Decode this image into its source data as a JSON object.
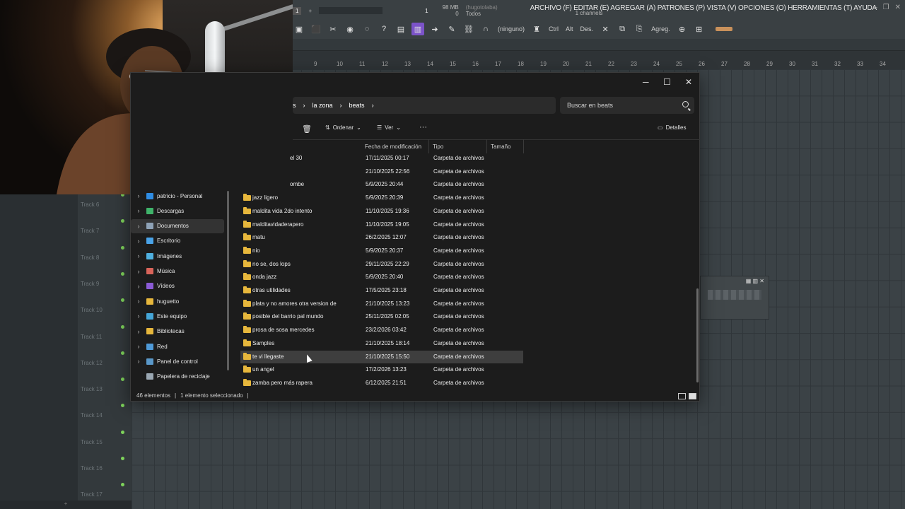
{
  "fl": {
    "menu": "ARCHIVO (F) EDITAR (E) AGREGAR (A) PATRONES (P) VISTA (V) OPCIONES (O) HERRAMIENTAS (T) AYUDA",
    "top_field": "1",
    "meter_value": "1",
    "memory": "98 MB",
    "memory_count": "0",
    "user_hint": "(hugotolaba)",
    "channels_filter": "Todos",
    "channels": "1 channels",
    "toolbar_none": "(ninguno)",
    "ctrl": "Ctrl",
    "alt": "Alt",
    "des": "Des.",
    "agreg": "Agreg.",
    "ruler": [
      "9",
      "10",
      "11",
      "12",
      "13",
      "14",
      "15",
      "16",
      "17",
      "18",
      "19",
      "20",
      "21",
      "22",
      "23",
      "24",
      "25",
      "26",
      "27",
      "28",
      "29",
      "30",
      "31",
      "32",
      "33",
      "34"
    ],
    "tracks": [
      "Track 6",
      "Track 7",
      "Track 8",
      "Track 9",
      "Track 10",
      "Track 11",
      "Track 12",
      "Track 13",
      "Track 14",
      "Track 15",
      "Track 16",
      "Track 17"
    ],
    "plus": "+"
  },
  "explorer": {
    "breadcrumb": [
      "s",
      "la zona",
      "beats"
    ],
    "search_placeholder": "Buscar en beats",
    "cmd_sort": "Ordenar",
    "cmd_view": "Ver",
    "cmd_more": "···",
    "cmd_details": "Detalles",
    "columns": {
      "date": "Fecha de modificación",
      "type": "Tipo",
      "size": "Tamaño"
    },
    "nav": [
      {
        "label": "patricio - Personal",
        "color": "#2f8de4"
      },
      {
        "label": "Descargas",
        "color": "#3fb36a"
      },
      {
        "label": "Documentos",
        "color": "#8ea2b6"
      },
      {
        "label": "Escritorio",
        "color": "#4aa3e8"
      },
      {
        "label": "Imágenes",
        "color": "#4fb0e0"
      },
      {
        "label": "Música",
        "color": "#d9645a"
      },
      {
        "label": "Vídeos",
        "color": "#8b5bd6"
      },
      {
        "label": "huguetto",
        "color": "#e7b73c"
      },
      {
        "label": "Este equipo",
        "color": "#45a6d8"
      },
      {
        "label": "Bibliotecas",
        "color": "#e7b73c"
      },
      {
        "label": "Red",
        "color": "#4f9ad8"
      },
      {
        "label": "Panel de control",
        "color": "#5a98c9"
      },
      {
        "label": "Papelera de reciclaje",
        "color": "#9aa7b2"
      }
    ],
    "files": [
      {
        "name": "el 30",
        "date": "17/11/2025 00:17",
        "type": "Carpeta de archivos"
      },
      {
        "name": "",
        "date": "21/10/2025 22:56",
        "type": "Carpeta de archivos"
      },
      {
        "name": "ombe",
        "date": "5/9/2025 20:44",
        "type": "Carpeta de archivos"
      },
      {
        "name": "jazz ligero",
        "date": "5/9/2025 20:39",
        "type": "Carpeta de archivos"
      },
      {
        "name": "maldita vida 2do intento",
        "date": "11/10/2025 19:36",
        "type": "Carpeta de archivos"
      },
      {
        "name": "malditavidaderapero",
        "date": "11/10/2025 19:05",
        "type": "Carpeta de archivos"
      },
      {
        "name": "matu",
        "date": "26/2/2025 12:07",
        "type": "Carpeta de archivos"
      },
      {
        "name": "nio",
        "date": "5/9/2025 20:37",
        "type": "Carpeta de archivos"
      },
      {
        "name": "no se, dos lops",
        "date": "29/11/2025 22:29",
        "type": "Carpeta de archivos"
      },
      {
        "name": "onda jazz",
        "date": "5/9/2025 20:40",
        "type": "Carpeta de archivos"
      },
      {
        "name": "otras utilidades",
        "date": "17/5/2025 23:18",
        "type": "Carpeta de archivos"
      },
      {
        "name": "plata y no amores otra version de",
        "date": "21/10/2025 13:23",
        "type": "Carpeta de archivos"
      },
      {
        "name": "posible del barrio pal mundo",
        "date": "25/11/2025 02:05",
        "type": "Carpeta de archivos"
      },
      {
        "name": "prosa de sosa mercedes",
        "date": "23/2/2026 03:42",
        "type": "Carpeta de archivos"
      },
      {
        "name": "Samples",
        "date": "21/10/2025 18:14",
        "type": "Carpeta de archivos"
      },
      {
        "name": "te vi llegaste",
        "date": "21/10/2025 15:50",
        "type": "Carpeta de archivos"
      },
      {
        "name": "un angel",
        "date": "17/2/2026 13:23",
        "type": "Carpeta de archivos"
      },
      {
        "name": "zamba pero más rapera",
        "date": "6/12/2025 21:51",
        "type": "Carpeta de archivos"
      }
    ],
    "selected_index": 15,
    "status_count": "46 elementos",
    "status_selected": "1 elemento seleccionado",
    "status_sep": "|"
  }
}
